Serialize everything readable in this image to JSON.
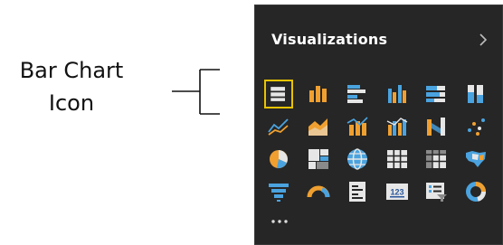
{
  "annotation": {
    "line1": "Bar Chart",
    "line2": "Icon"
  },
  "panel": {
    "title": "Visualizations",
    "expand_icon": "chevron-right-icon",
    "more_icon": "ellipsis-icon"
  },
  "colors": {
    "panel_bg": "#262626",
    "selection": "#e8c300",
    "accent_orange": "#f0a030",
    "accent_blue": "#4aa3df",
    "accent_white": "#e6e6e6"
  },
  "visual_icons": [
    {
      "name": "stacked-bar-chart-icon",
      "selected": true
    },
    {
      "name": "stacked-column-chart-icon",
      "selected": false
    },
    {
      "name": "clustered-bar-chart-icon",
      "selected": false
    },
    {
      "name": "clustered-column-chart-icon",
      "selected": false
    },
    {
      "name": "100-percent-stacked-bar-chart-icon",
      "selected": false
    },
    {
      "name": "100-percent-stacked-column-chart-icon",
      "selected": false
    },
    {
      "name": "line-chart-icon",
      "selected": false
    },
    {
      "name": "area-chart-icon",
      "selected": false
    },
    {
      "name": "line-and-stacked-column-chart-icon",
      "selected": false
    },
    {
      "name": "line-and-clustered-column-chart-icon",
      "selected": false
    },
    {
      "name": "ribbon-chart-icon",
      "selected": false
    },
    {
      "name": "scatter-chart-icon",
      "selected": false
    },
    {
      "name": "pie-chart-icon",
      "selected": false
    },
    {
      "name": "treemap-icon",
      "selected": false
    },
    {
      "name": "map-icon",
      "selected": false
    },
    {
      "name": "table-icon",
      "selected": false
    },
    {
      "name": "matrix-icon",
      "selected": false
    },
    {
      "name": "filled-map-icon",
      "selected": false
    },
    {
      "name": "funnel-icon",
      "selected": false
    },
    {
      "name": "gauge-icon",
      "selected": false
    },
    {
      "name": "multi-row-card-icon",
      "selected": false
    },
    {
      "name": "card-icon",
      "selected": false
    },
    {
      "name": "slicer-icon",
      "selected": false
    },
    {
      "name": "donut-chart-icon",
      "selected": false
    }
  ],
  "card_icon_text": "123"
}
